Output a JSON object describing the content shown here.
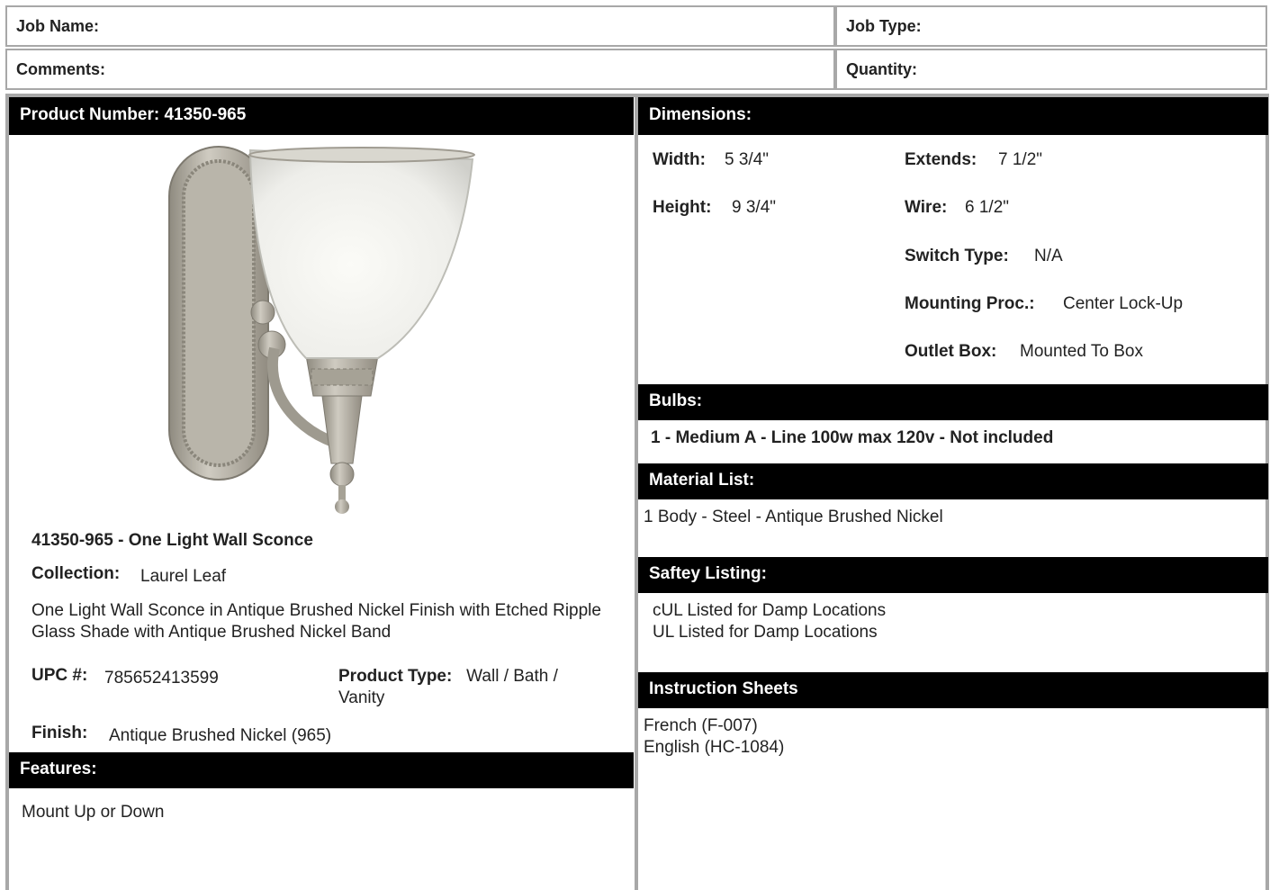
{
  "header": {
    "job_name": "Job Name:",
    "job_type": "Job Type:",
    "comments": "Comments:",
    "quantity": "Quantity:"
  },
  "product": {
    "number_bar": "Product Number: 41350-965",
    "title": "41350-965 - One Light Wall Sconce",
    "collection_label": "Collection:",
    "collection_value": "Laurel Leaf",
    "description": "One Light Wall Sconce in Antique Brushed Nickel Finish with Etched Ripple Glass Shade with Antique Brushed Nickel Band",
    "upc_label": "UPC #:",
    "upc_value": "785652413599",
    "type_label": "Product Type:",
    "type_value": "Wall / Bath / Vanity",
    "finish_label": "Finish:",
    "finish_value": "Antique Brushed Nickel (965)"
  },
  "features": {
    "bar": "Features:",
    "items": [
      "Mount Up or Down"
    ]
  },
  "dimensions": {
    "bar": "Dimensions:",
    "width_label": "Width:",
    "width_value": "5 3/4\"",
    "extends_label": "Extends:",
    "extends_value": "7 1/2\"",
    "height_label": "Height:",
    "height_value": "9 3/4\"",
    "wire_label": "Wire:",
    "wire_value": "6 1/2\"",
    "switch_label": "Switch Type:",
    "switch_value": "N/A",
    "mounting_label": "Mounting Proc.:",
    "mounting_value": "Center Lock-Up",
    "outlet_label": "Outlet Box:",
    "outlet_value": "Mounted To Box"
  },
  "bulbs": {
    "bar": "Bulbs:",
    "value": "1 - Medium A - Line 100w max 120v - Not included"
  },
  "materials": {
    "bar": "Material List:",
    "items": [
      "1 Body - Steel - Antique Brushed Nickel"
    ]
  },
  "safety": {
    "bar": "Saftey Listing:",
    "items": [
      "cUL Listed for Damp Locations",
      "UL Listed for Damp Locations"
    ]
  },
  "instructions": {
    "bar": "Instruction Sheets",
    "items": [
      "French (F-007)",
      "English (HC-1084)"
    ]
  },
  "colors": {
    "bar_bg": "#000000",
    "border": "#a8a8a8",
    "nickel": "#a9a59a"
  }
}
